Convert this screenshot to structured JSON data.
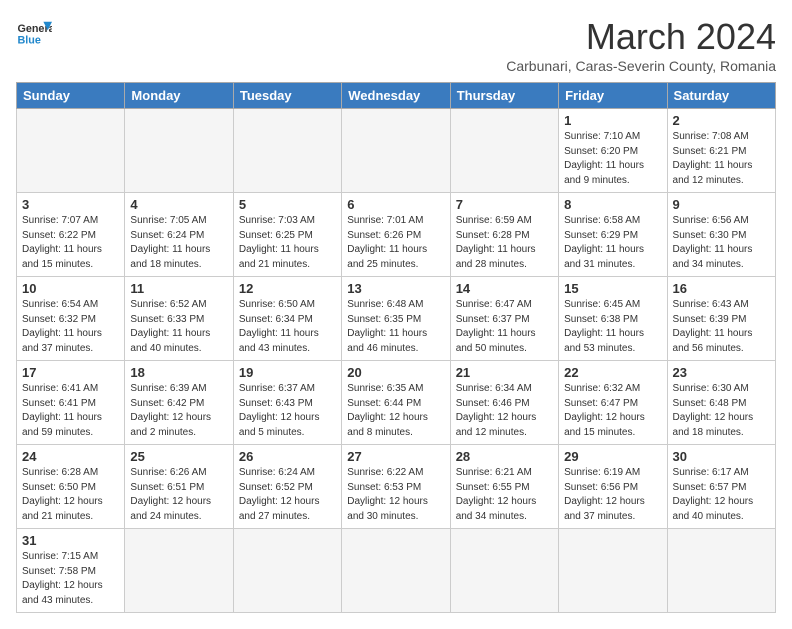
{
  "logo": {
    "text_general": "General",
    "text_blue": "Blue"
  },
  "header": {
    "month_year": "March 2024",
    "location": "Carbunari, Caras-Severin County, Romania"
  },
  "days_of_week": [
    "Sunday",
    "Monday",
    "Tuesday",
    "Wednesday",
    "Thursday",
    "Friday",
    "Saturday"
  ],
  "weeks": [
    [
      {
        "day": "",
        "info": ""
      },
      {
        "day": "",
        "info": ""
      },
      {
        "day": "",
        "info": ""
      },
      {
        "day": "",
        "info": ""
      },
      {
        "day": "",
        "info": ""
      },
      {
        "day": "1",
        "info": "Sunrise: 7:10 AM\nSunset: 6:20 PM\nDaylight: 11 hours\nand 9 minutes."
      },
      {
        "day": "2",
        "info": "Sunrise: 7:08 AM\nSunset: 6:21 PM\nDaylight: 11 hours\nand 12 minutes."
      }
    ],
    [
      {
        "day": "3",
        "info": "Sunrise: 7:07 AM\nSunset: 6:22 PM\nDaylight: 11 hours\nand 15 minutes."
      },
      {
        "day": "4",
        "info": "Sunrise: 7:05 AM\nSunset: 6:24 PM\nDaylight: 11 hours\nand 18 minutes."
      },
      {
        "day": "5",
        "info": "Sunrise: 7:03 AM\nSunset: 6:25 PM\nDaylight: 11 hours\nand 21 minutes."
      },
      {
        "day": "6",
        "info": "Sunrise: 7:01 AM\nSunset: 6:26 PM\nDaylight: 11 hours\nand 25 minutes."
      },
      {
        "day": "7",
        "info": "Sunrise: 6:59 AM\nSunset: 6:28 PM\nDaylight: 11 hours\nand 28 minutes."
      },
      {
        "day": "8",
        "info": "Sunrise: 6:58 AM\nSunset: 6:29 PM\nDaylight: 11 hours\nand 31 minutes."
      },
      {
        "day": "9",
        "info": "Sunrise: 6:56 AM\nSunset: 6:30 PM\nDaylight: 11 hours\nand 34 minutes."
      }
    ],
    [
      {
        "day": "10",
        "info": "Sunrise: 6:54 AM\nSunset: 6:32 PM\nDaylight: 11 hours\nand 37 minutes."
      },
      {
        "day": "11",
        "info": "Sunrise: 6:52 AM\nSunset: 6:33 PM\nDaylight: 11 hours\nand 40 minutes."
      },
      {
        "day": "12",
        "info": "Sunrise: 6:50 AM\nSunset: 6:34 PM\nDaylight: 11 hours\nand 43 minutes."
      },
      {
        "day": "13",
        "info": "Sunrise: 6:48 AM\nSunset: 6:35 PM\nDaylight: 11 hours\nand 46 minutes."
      },
      {
        "day": "14",
        "info": "Sunrise: 6:47 AM\nSunset: 6:37 PM\nDaylight: 11 hours\nand 50 minutes."
      },
      {
        "day": "15",
        "info": "Sunrise: 6:45 AM\nSunset: 6:38 PM\nDaylight: 11 hours\nand 53 minutes."
      },
      {
        "day": "16",
        "info": "Sunrise: 6:43 AM\nSunset: 6:39 PM\nDaylight: 11 hours\nand 56 minutes."
      }
    ],
    [
      {
        "day": "17",
        "info": "Sunrise: 6:41 AM\nSunset: 6:41 PM\nDaylight: 11 hours\nand 59 minutes."
      },
      {
        "day": "18",
        "info": "Sunrise: 6:39 AM\nSunset: 6:42 PM\nDaylight: 12 hours\nand 2 minutes."
      },
      {
        "day": "19",
        "info": "Sunrise: 6:37 AM\nSunset: 6:43 PM\nDaylight: 12 hours\nand 5 minutes."
      },
      {
        "day": "20",
        "info": "Sunrise: 6:35 AM\nSunset: 6:44 PM\nDaylight: 12 hours\nand 8 minutes."
      },
      {
        "day": "21",
        "info": "Sunrise: 6:34 AM\nSunset: 6:46 PM\nDaylight: 12 hours\nand 12 minutes."
      },
      {
        "day": "22",
        "info": "Sunrise: 6:32 AM\nSunset: 6:47 PM\nDaylight: 12 hours\nand 15 minutes."
      },
      {
        "day": "23",
        "info": "Sunrise: 6:30 AM\nSunset: 6:48 PM\nDaylight: 12 hours\nand 18 minutes."
      }
    ],
    [
      {
        "day": "24",
        "info": "Sunrise: 6:28 AM\nSunset: 6:50 PM\nDaylight: 12 hours\nand 21 minutes."
      },
      {
        "day": "25",
        "info": "Sunrise: 6:26 AM\nSunset: 6:51 PM\nDaylight: 12 hours\nand 24 minutes."
      },
      {
        "day": "26",
        "info": "Sunrise: 6:24 AM\nSunset: 6:52 PM\nDaylight: 12 hours\nand 27 minutes."
      },
      {
        "day": "27",
        "info": "Sunrise: 6:22 AM\nSunset: 6:53 PM\nDaylight: 12 hours\nand 30 minutes."
      },
      {
        "day": "28",
        "info": "Sunrise: 6:21 AM\nSunset: 6:55 PM\nDaylight: 12 hours\nand 34 minutes."
      },
      {
        "day": "29",
        "info": "Sunrise: 6:19 AM\nSunset: 6:56 PM\nDaylight: 12 hours\nand 37 minutes."
      },
      {
        "day": "30",
        "info": "Sunrise: 6:17 AM\nSunset: 6:57 PM\nDaylight: 12 hours\nand 40 minutes."
      }
    ],
    [
      {
        "day": "31",
        "info": "Sunrise: 7:15 AM\nSunset: 7:58 PM\nDaylight: 12 hours\nand 43 minutes."
      },
      {
        "day": "",
        "info": ""
      },
      {
        "day": "",
        "info": ""
      },
      {
        "day": "",
        "info": ""
      },
      {
        "day": "",
        "info": ""
      },
      {
        "day": "",
        "info": ""
      },
      {
        "day": "",
        "info": ""
      }
    ]
  ]
}
